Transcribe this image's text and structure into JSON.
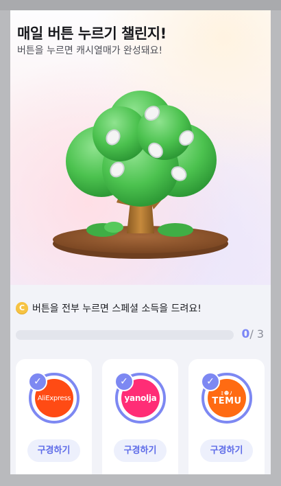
{
  "page": {
    "title": "매일 버튼 누르기 챌린지!",
    "subtitle": "버튼을 누르면 캐시열매가 완성돼요!"
  },
  "mission": {
    "coin_symbol": "C",
    "text": "버튼을 전부 누르면 스페셜 소득을 드려요!",
    "progress": {
      "current": "0",
      "separator": "/ ",
      "total": "3",
      "fraction": 0
    }
  },
  "brands": [
    {
      "logo_text": "AliExpress",
      "button_label": "구경하기",
      "checked": true,
      "color": "#ff4b14"
    },
    {
      "logo_text": "yanolja",
      "button_label": "구경하기",
      "checked": true,
      "color": "#ff2d76"
    },
    {
      "logo_mark": "ﾐ☻ﾉ",
      "logo_text": "TEMU",
      "button_label": "구경하기",
      "checked": true,
      "color": "#ff6b12"
    }
  ],
  "colors": {
    "accent": "#7d88f2",
    "button_text": "#5c6ae8",
    "coin": "#f6c343"
  },
  "icons": {
    "check": "check-icon",
    "coin": "coin-icon",
    "illustration": "cash-tree-illustration"
  }
}
